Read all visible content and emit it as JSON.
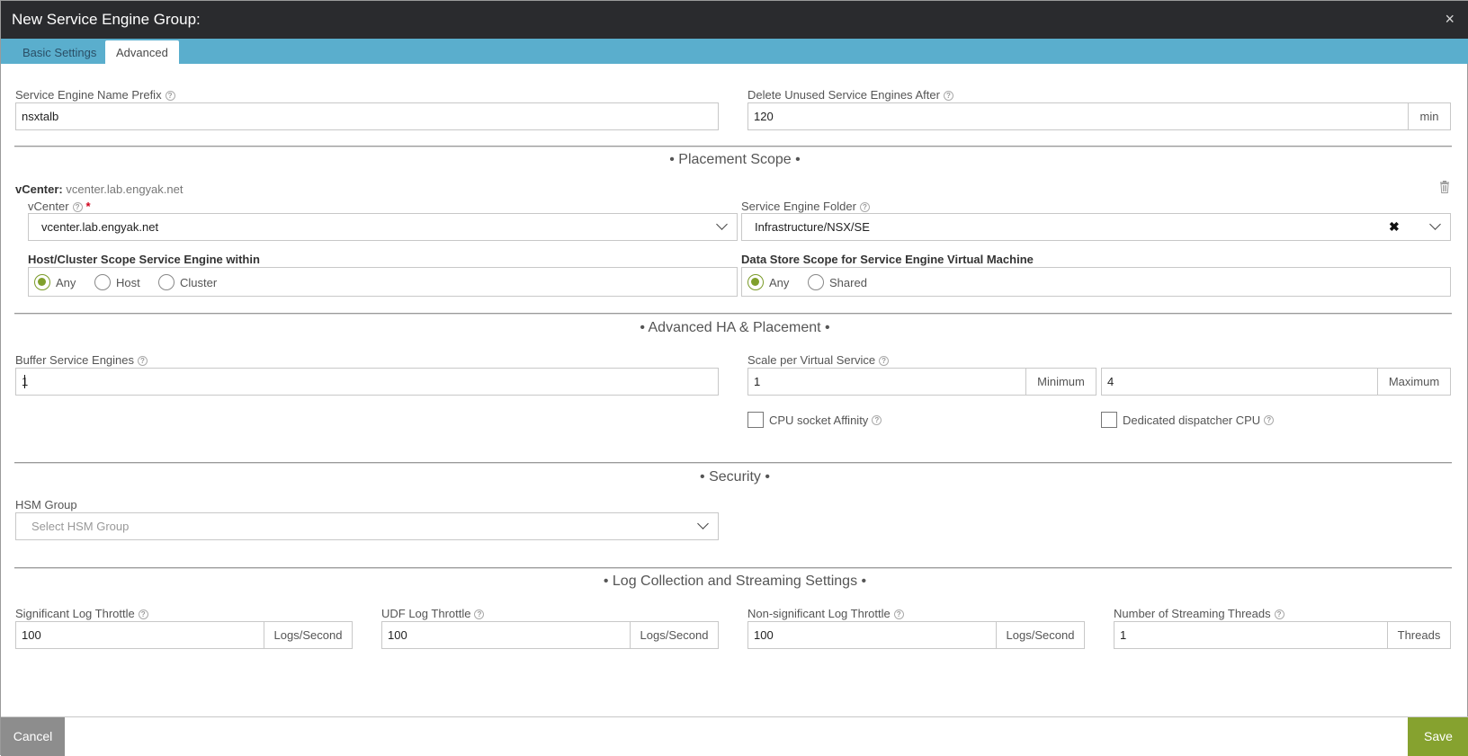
{
  "window": {
    "title": "New Service Engine Group:",
    "close_glyph": "×"
  },
  "tabs": [
    {
      "label": "Basic Settings"
    },
    {
      "label": "Advanced"
    }
  ],
  "se_name_prefix": {
    "label": "Service Engine Name Prefix",
    "value": "nsxtalb"
  },
  "delete_unused": {
    "label": "Delete Unused Service Engines After",
    "value": "120",
    "unit": "min"
  },
  "placement_scope": {
    "title": "• Placement Scope •",
    "vcenter_header_key": "vCenter:",
    "vcenter_header_value": "vcenter.lab.engyak.net",
    "vcenter_label": "vCenter",
    "vcenter_value": "vcenter.lab.engyak.net",
    "folder_label": "Service Engine Folder",
    "folder_value": "Infrastructure/NSX/SE",
    "host_scope_label": "Host/Cluster Scope Service Engine within",
    "host_scope_options": [
      "Any",
      "Host",
      "Cluster"
    ],
    "host_scope_selected": "Any",
    "datastore_label": "Data Store Scope for Service Engine Virtual Machine",
    "datastore_options": [
      "Any",
      "Shared"
    ],
    "datastore_selected": "Any"
  },
  "advanced_ha": {
    "title": "• Advanced HA & Placement •",
    "buffer_label": "Buffer Service Engines",
    "buffer_value": "1",
    "scale_label": "Scale per Virtual Service",
    "scale_min_value": "1",
    "scale_min_unit": "Minimum",
    "scale_max_value": "4",
    "scale_max_unit": "Maximum",
    "cpu_affinity_label": "CPU socket Affinity",
    "cpu_affinity_checked": false,
    "dispatcher_label": "Dedicated dispatcher CPU",
    "dispatcher_checked": false
  },
  "security": {
    "title": "• Security •",
    "hsm_label": "HSM Group",
    "hsm_placeholder": "Select HSM Group"
  },
  "log": {
    "title": "• Log Collection and Streaming Settings •",
    "fields": [
      {
        "label": "Significant Log Throttle",
        "value": "100",
        "unit": "Logs/Second"
      },
      {
        "label": "UDF Log Throttle",
        "value": "100",
        "unit": "Logs/Second"
      },
      {
        "label": "Non-significant Log Throttle",
        "value": "100",
        "unit": "Logs/Second"
      },
      {
        "label": "Number of Streaming Threads",
        "value": "1",
        "unit": "Threads"
      }
    ]
  },
  "footer": {
    "cancel_label": "Cancel",
    "save_label": "Save"
  },
  "colors": {
    "titlebar": "#2a2b2e",
    "tabbar": "#5aaecd",
    "accent_green": "#86a22f",
    "cancel_gray": "#8d8d8d"
  }
}
